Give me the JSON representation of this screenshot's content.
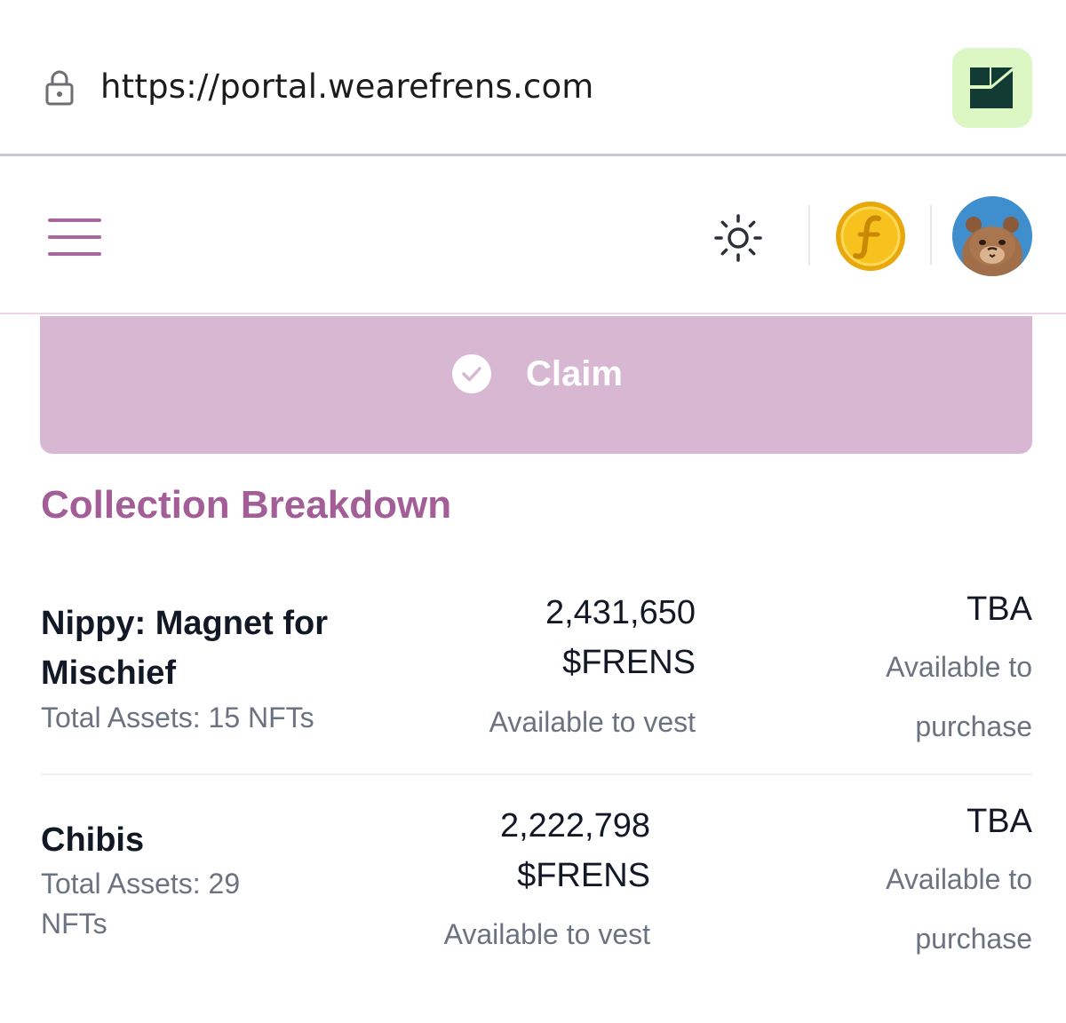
{
  "browser": {
    "url": "https://portal.wearefrens.com"
  },
  "header": {
    "menu_icon": "hamburger-menu-icon",
    "theme_icon": "sun-icon",
    "token_icon": "frens-coin-icon",
    "avatar_icon": "hamster-avatar"
  },
  "claim": {
    "label": "Claim"
  },
  "section": {
    "title": "Collection Breakdown"
  },
  "collections": [
    {
      "name": "Nippy: Magnet for Mischief",
      "assets": "Total Assets: 15 NFTs",
      "amount": "2,431,650 $FRENS",
      "vest_label": "Available to vest",
      "tba": "TBA",
      "purchase_label": "Available to purchase"
    },
    {
      "name": "Chibis",
      "assets": "Total Assets: 29 NFTs",
      "amount": "2,222,798 $FRENS",
      "vest_label": "Available to vest",
      "tba": "TBA",
      "purchase_label": "Available to purchase"
    }
  ],
  "colors": {
    "accent": "#a35e98",
    "claim_bg": "#d8b7d3",
    "muted_text": "#6b7280"
  }
}
